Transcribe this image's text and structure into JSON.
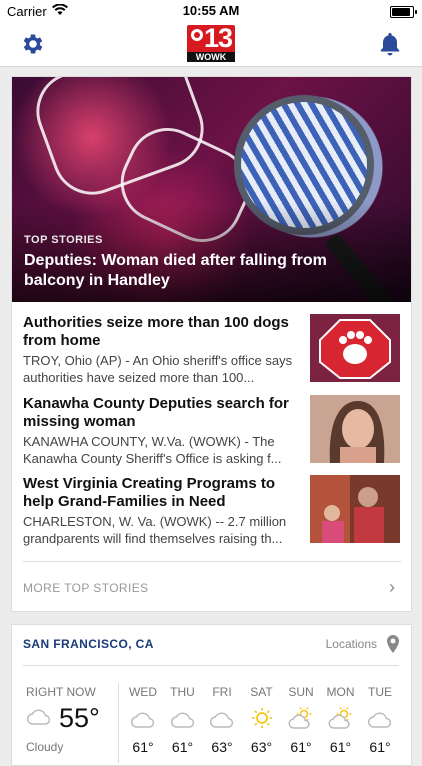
{
  "status_bar": {
    "carrier": "Carrier",
    "time": "10:55 AM",
    "battery_level": 1.0
  },
  "header": {
    "logo_number": "13",
    "logo_call": "WOWK"
  },
  "top_story": {
    "tag": "TOP STORIES",
    "headline": "Deputies: Woman died after falling from balcony in Handley"
  },
  "stories": [
    {
      "title": "Authorities seize more than 100 dogs from home",
      "snippet": "TROY, Ohio (AP) - An Ohio sheriff's office says authorities have seized more than 100..."
    },
    {
      "title": "Kanawha County Deputies search for missing woman",
      "snippet": "KANAWHA COUNTY, W.Va. (WOWK) - The Kanawha County Sheriff's Office is asking f..."
    },
    {
      "title": "West Virginia Creating Programs to help Grand-Families in Need",
      "snippet": "CHARLESTON, W. Va. (WOWK) -- 2.7 million grandparents will find themselves raising th..."
    }
  ],
  "more_link": "MORE TOP STORIES",
  "weather": {
    "city": "SAN FRANCISCO, CA",
    "locations_label": "Locations",
    "now_label": "RIGHT NOW",
    "now_temp": "55°",
    "now_condition": "Cloudy",
    "days": [
      {
        "name": "WED",
        "icon": "cloud",
        "temp": "61°"
      },
      {
        "name": "THU",
        "icon": "cloud",
        "temp": "61°"
      },
      {
        "name": "FRI",
        "icon": "cloud",
        "temp": "63°"
      },
      {
        "name": "SAT",
        "icon": "sun",
        "temp": "63°"
      },
      {
        "name": "SUN",
        "icon": "partly-sunny",
        "temp": "61°"
      },
      {
        "name": "MON",
        "icon": "partly-sunny",
        "temp": "61°"
      },
      {
        "name": "TUE",
        "icon": "cloud",
        "temp": "61°"
      }
    ]
  },
  "colors": {
    "brand_blue": "#2b4a9a",
    "brand_red": "#d71920",
    "sun": "#f5c518"
  }
}
